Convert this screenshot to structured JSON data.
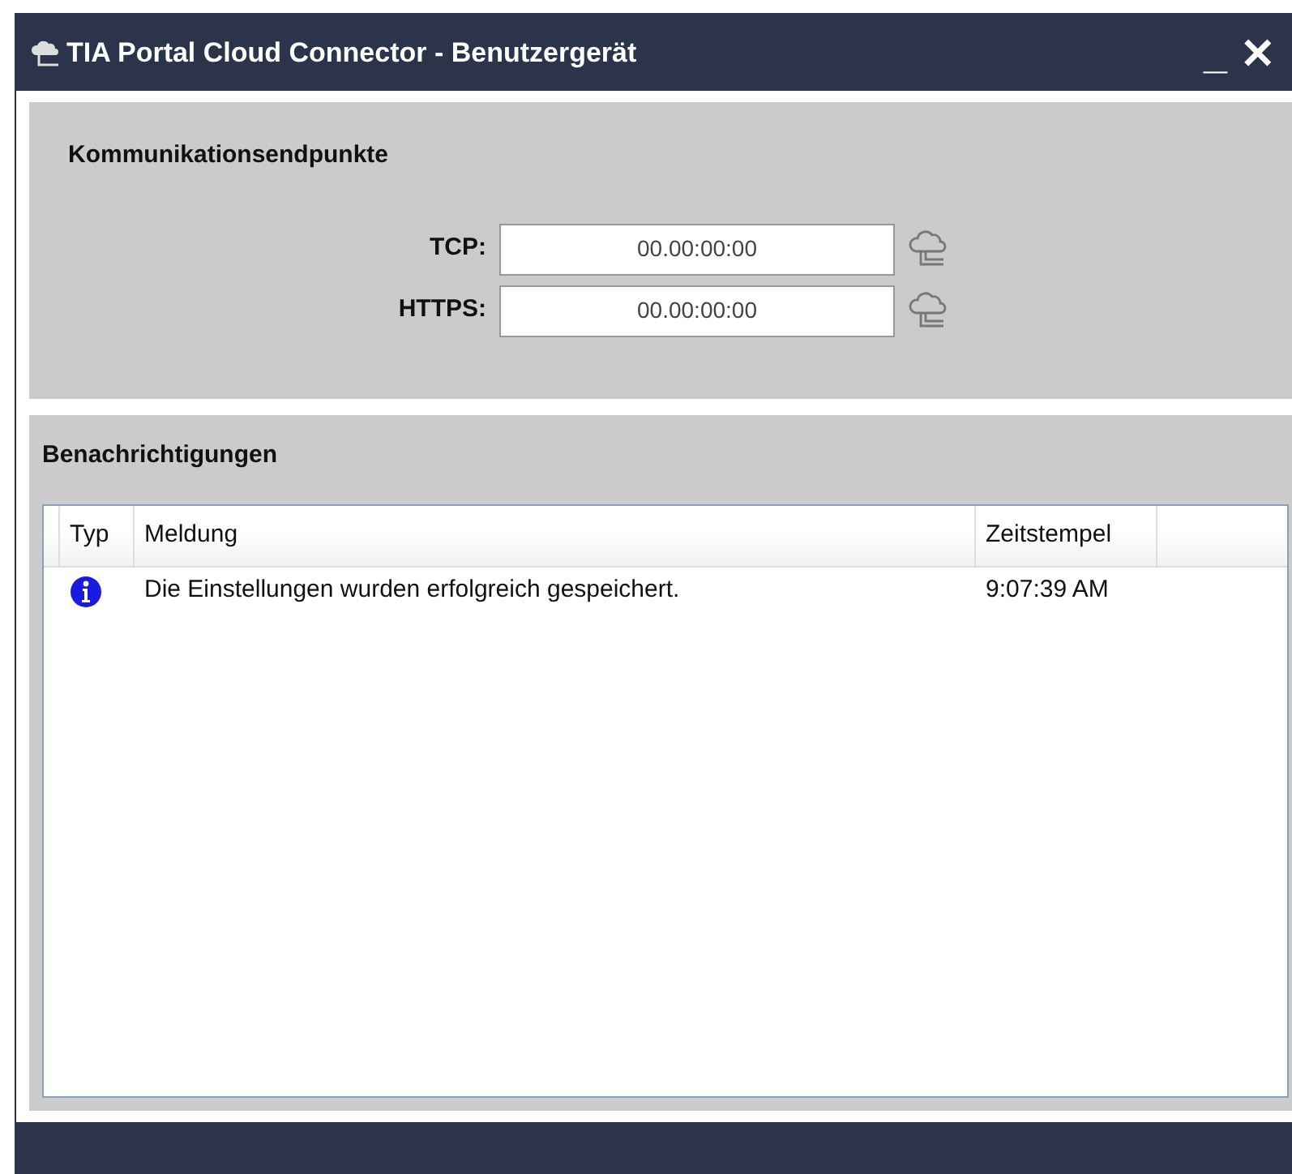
{
  "window": {
    "title": "TIA Portal Cloud Connector - Benutzergerät",
    "minimize": "_",
    "close": "✕"
  },
  "endpoints": {
    "heading": "Kommunikationsendpunkte",
    "items": [
      {
        "label": "TCP:",
        "value": "00.00:00:00"
      },
      {
        "label": "HTTPS:",
        "value": "00.00:00:00"
      }
    ]
  },
  "notifications": {
    "heading": "Benachrichtigungen",
    "columns": [
      "Typ",
      "Meldung",
      "Zeitstempel"
    ],
    "rows": [
      {
        "kind": "info",
        "message": "Die Einstellungen wurden erfolgreich gespeichert.",
        "time": "9:07:39 AM"
      }
    ]
  }
}
